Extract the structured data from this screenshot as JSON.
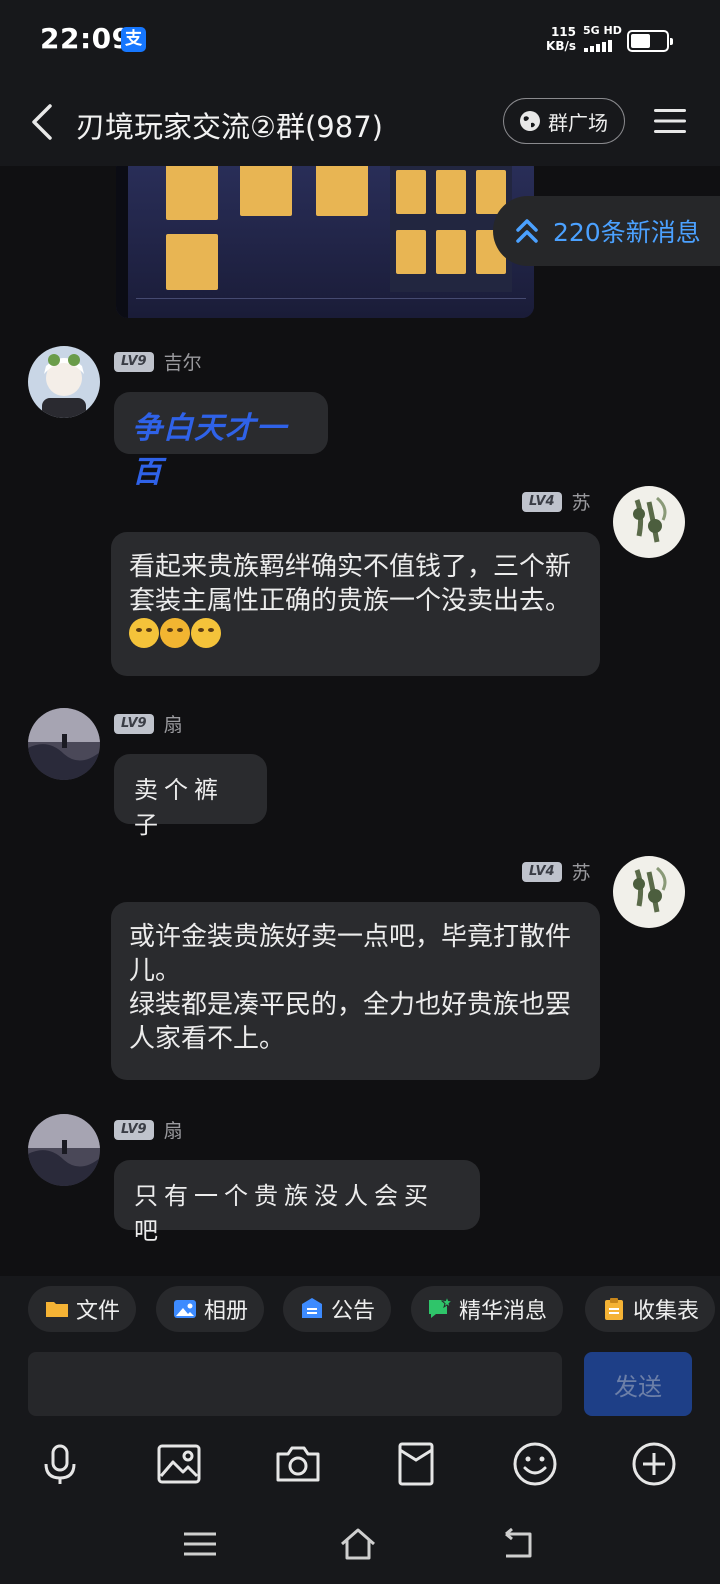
{
  "status_bar": {
    "time": "22:09",
    "alipay_badge": "支",
    "net_speed_value": "115",
    "net_speed_unit": "KB/s",
    "network": "5G HD",
    "battery_level": 0.55
  },
  "header": {
    "title": "刃境玩家交流②群(987)",
    "plaza_label": "群广场"
  },
  "new_messages_label": "220条新消息",
  "messages": [
    {
      "side": "left",
      "level": "LV9",
      "name": "吉尔",
      "text": "争白天才一百"
    },
    {
      "side": "right",
      "level": "LV4",
      "name": "苏",
      "text": "看起来贵族羁绊确实不值钱了，三个新套装主属性正确的贵族一个没卖出去。"
    },
    {
      "side": "left",
      "level": "LV9",
      "name": "扇",
      "text": "卖个裤子"
    },
    {
      "side": "right",
      "level": "LV4",
      "name": "苏",
      "text_line1": "或许金装贵族好卖一点吧，毕竟打散件儿。",
      "text_line2": "绿装都是凑平民的，全力也好贵族也罢人家看不上。"
    },
    {
      "side": "left",
      "level": "LV9",
      "name": "扇",
      "text": "只有一个贵族没人会买吧"
    }
  ],
  "quick_actions": [
    {
      "label": "文件",
      "icon": "folder-icon",
      "color": "#f5b335"
    },
    {
      "label": "相册",
      "icon": "album-icon",
      "color": "#3d8bff"
    },
    {
      "label": "公告",
      "icon": "announcement-icon",
      "color": "#3d8bff"
    },
    {
      "label": "精华消息",
      "icon": "highlight-icon",
      "color": "#2fc56a"
    },
    {
      "label": "收集表",
      "icon": "clipboard-icon",
      "color": "#f5b335"
    }
  ],
  "input": {
    "placeholder": "",
    "send_label": "发送"
  },
  "colors": {
    "accent": "#4ba1ff",
    "send_button": "#1e3f87",
    "bubble": "#2a2b2e",
    "background": "#101012"
  }
}
